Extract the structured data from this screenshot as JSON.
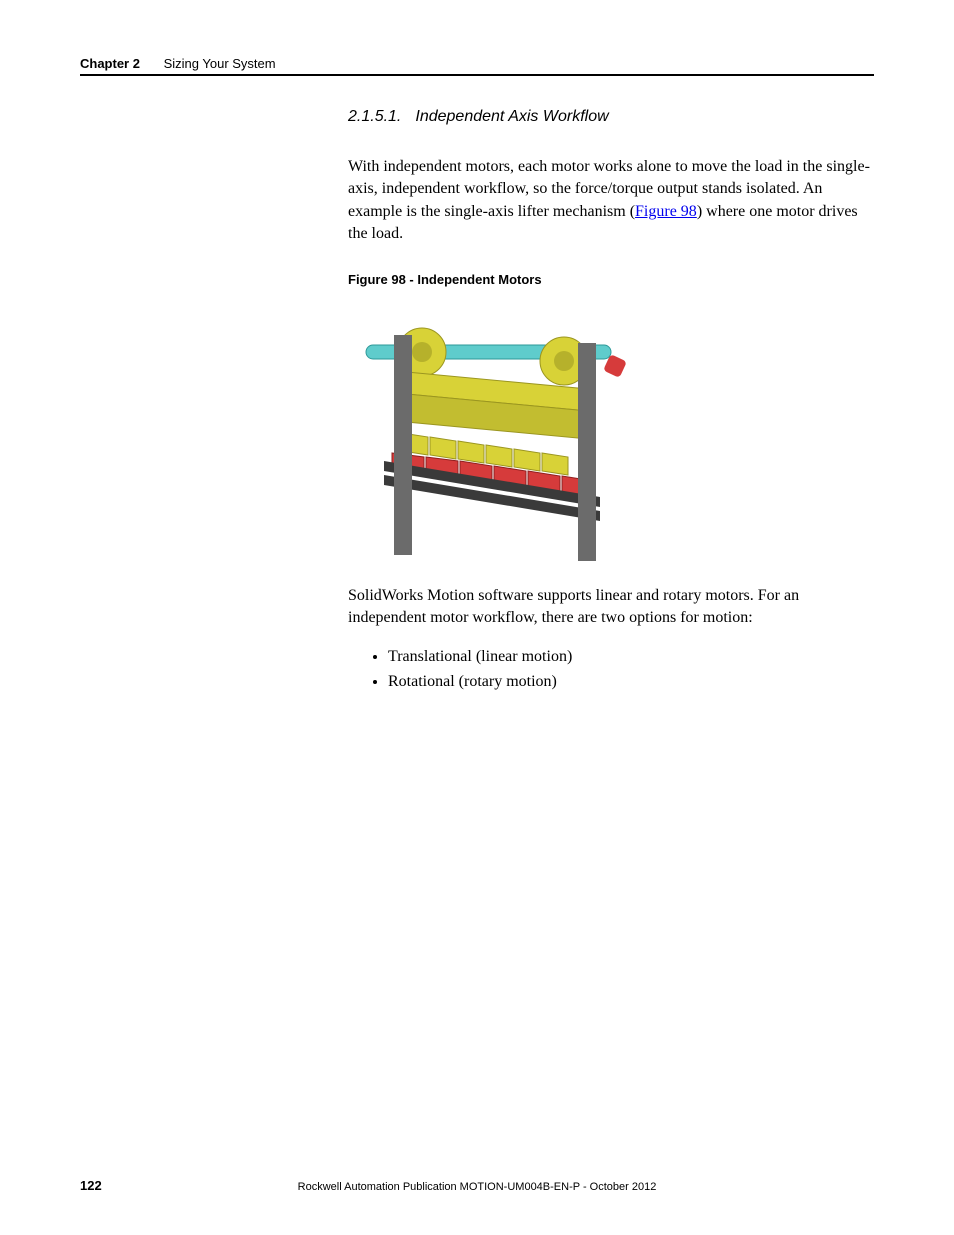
{
  "header": {
    "chapter_label": "Chapter 2",
    "chapter_title": "Sizing Your System"
  },
  "section": {
    "number": "2.1.5.1.",
    "title": "Independent Axis Workflow"
  },
  "paragraphs": {
    "p1a": "With independent motors, each motor works alone to move the load in the single-axis, independent workflow, so the force/torque output stands isolated. An example is the single-axis lifter mechanism (",
    "figure_link": "Figure 98",
    "p1b": ") where one motor drives the load.",
    "p2": "SolidWorks Motion software supports linear and rotary motors. For an independent motor workflow, there are two options for motion:"
  },
  "figure": {
    "caption": "Figure 98 - Independent Motors"
  },
  "bullets": {
    "b1": "Translational (linear motion)",
    "b2": "Rotational (rotary motion)"
  },
  "footer": {
    "page_number": "122",
    "publication": "Rockwell Automation Publication MOTION-UM004B-EN-P - October 2012"
  }
}
